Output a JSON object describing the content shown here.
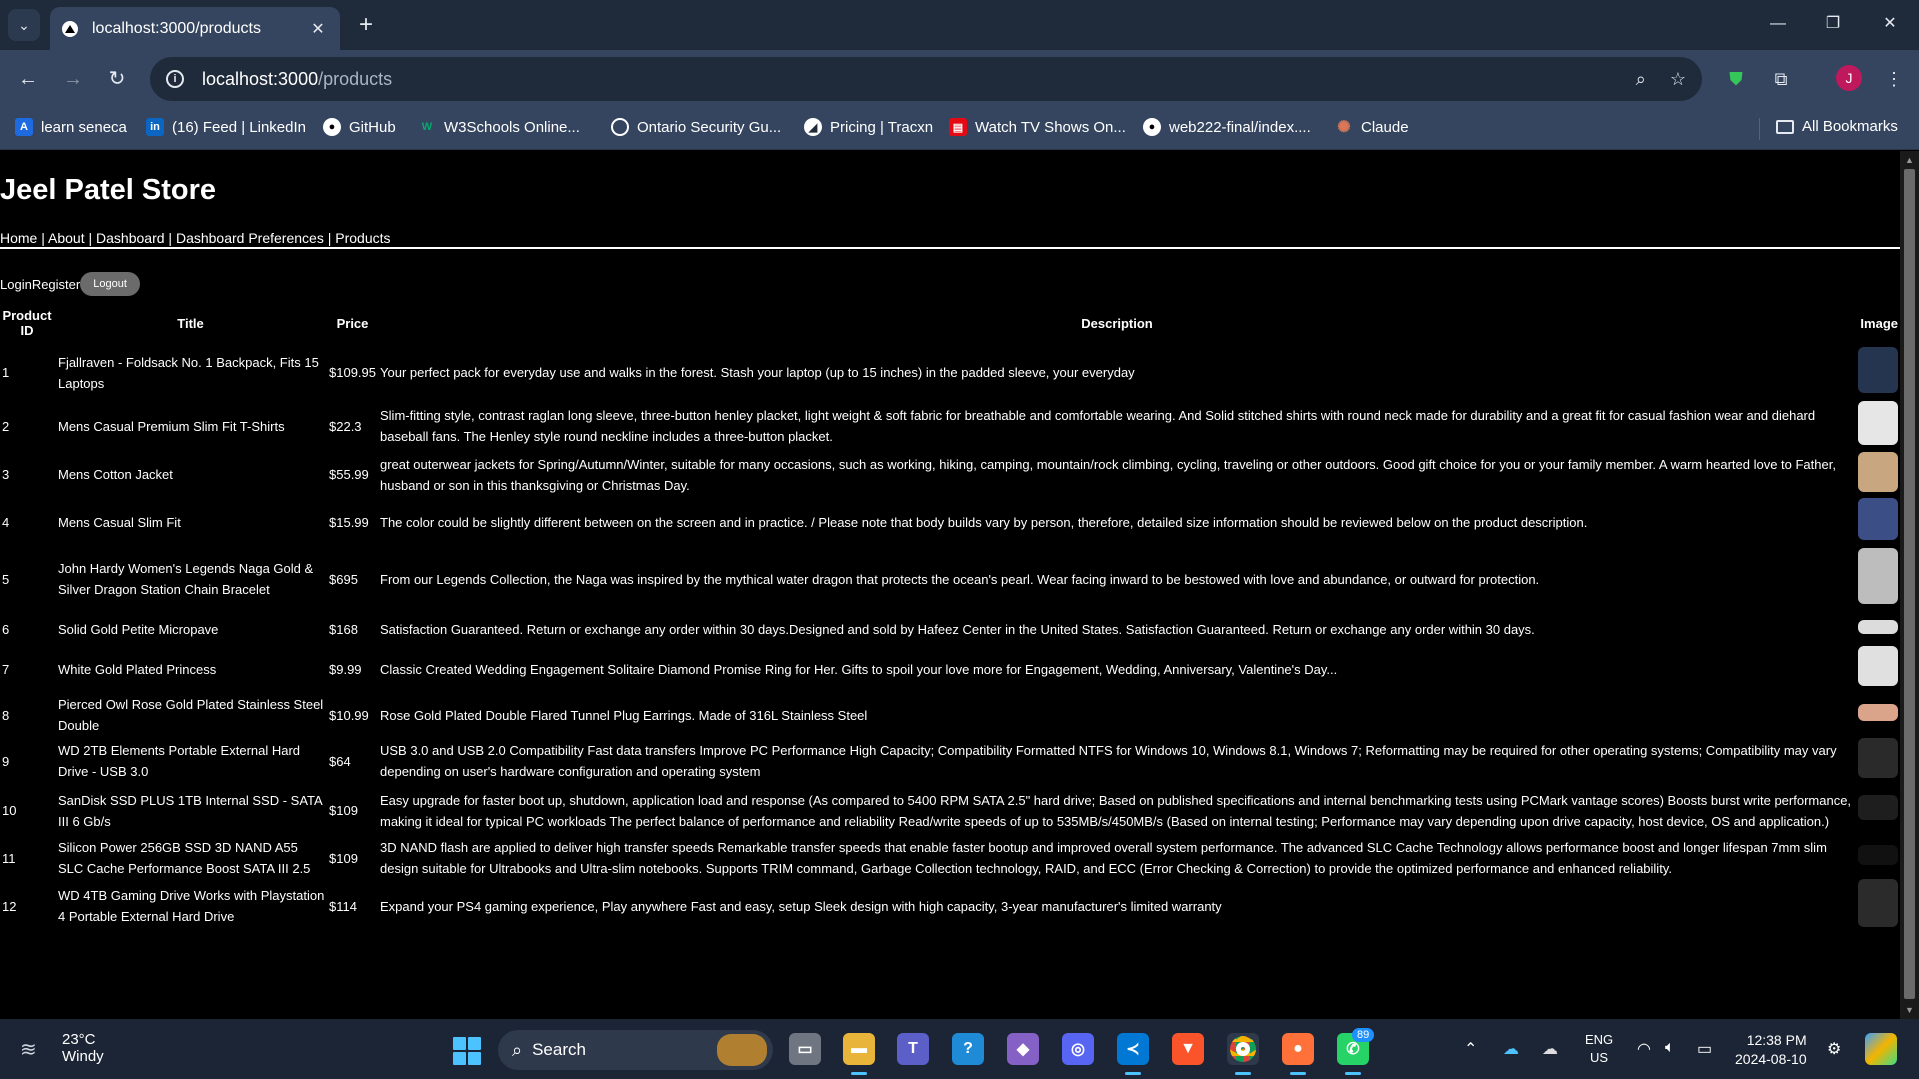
{
  "browser": {
    "tab_title": "localhost:3000/products",
    "url_host": "localhost:3000",
    "url_path": "/products",
    "profile_initial": "J",
    "bookmarks": [
      {
        "label": "learn seneca",
        "icon": "seneca-icon",
        "color": "#1e6ae0"
      },
      {
        "label": "(16) Feed | LinkedIn",
        "icon": "linkedin-icon",
        "color": "#0a66c2"
      },
      {
        "label": "GitHub",
        "icon": "github-icon",
        "color": "#ffffff"
      },
      {
        "label": "W3Schools Online...",
        "icon": "w3schools-icon",
        "color": "#04aa6d"
      },
      {
        "label": "Ontario Security Gu...",
        "icon": "globe-icon",
        "color": "#ffffff"
      },
      {
        "label": "Pricing | Tracxn",
        "icon": "tracxn-icon",
        "color": "#ffffff"
      },
      {
        "label": "Watch TV Shows On...",
        "icon": "tv-icon",
        "color": "#e50914"
      },
      {
        "label": "web222-final/index....",
        "icon": "github-icon",
        "color": "#ffffff"
      },
      {
        "label": "Claude",
        "icon": "claude-icon",
        "color": "#d97757"
      }
    ],
    "all_bookmarks": "All Bookmarks"
  },
  "site": {
    "title": "Jeel Patel Store",
    "nav": [
      "Home",
      "About",
      "Dashboard",
      "Dashboard Preferences",
      "Products"
    ],
    "login": "Login",
    "register": "Register",
    "logout": "Logout"
  },
  "table": {
    "headers": {
      "id": "Product ID",
      "title": "Title",
      "price": "Price",
      "description": "Description",
      "image": "Image"
    },
    "rows": [
      {
        "id": "1",
        "title": "Fjallraven - Foldsack No. 1 Backpack, Fits 15 Laptops",
        "price": "$109.95",
        "description": "Your perfect pack for everyday use and walks in the forest. Stash your laptop (up to 15 inches) in the padded sleeve, your everyday",
        "image": "backpack-image",
        "image_color": "#26354f"
      },
      {
        "id": "2",
        "title": "Mens Casual Premium Slim Fit T-Shirts",
        "price": "$22.3",
        "description": "Slim-fitting style, contrast raglan long sleeve, three-button henley placket, light weight & soft fabric for breathable and comfortable wearing. And Solid stitched shirts with round neck made for durability and a great fit for casual fashion wear and diehard baseball fans. The Henley style round neckline includes a three-button placket.",
        "image": "tshirt-image",
        "image_color": "#e6e6e6"
      },
      {
        "id": "3",
        "title": "Mens Cotton Jacket",
        "price": "$55.99",
        "description": "great outerwear jackets for Spring/Autumn/Winter, suitable for many occasions, such as working, hiking, camping, mountain/rock climbing, cycling, traveling or other outdoors. Good gift choice for you or your family member. A warm hearted love to Father, husband or son in this thanksgiving or Christmas Day.",
        "image": "jacket-image",
        "image_color": "#c8a780"
      },
      {
        "id": "4",
        "title": "Mens Casual Slim Fit",
        "price": "$15.99",
        "description": "The color could be slightly different between on the screen and in practice. / Please note that body builds vary by person, therefore, detailed size information should be reviewed below on the product description.",
        "image": "shirt-image",
        "image_color": "#3b4f86"
      },
      {
        "id": "5",
        "title": "John Hardy Women's Legends Naga Gold & Silver Dragon Station Chain Bracelet",
        "price": "$695",
        "description": "From our Legends Collection, the Naga was inspired by the mythical water dragon that protects the ocean's pearl. Wear facing inward to be bestowed with love and abundance, or outward for protection.",
        "image": "bracelet-image",
        "image_color": "#bdbdbd"
      },
      {
        "id": "6",
        "title": "Solid Gold Petite Micropave",
        "price": "$168",
        "description": "Satisfaction Guaranteed. Return or exchange any order within 30 days.Designed and sold by Hafeez Center in the United States. Satisfaction Guaranteed. Return or exchange any order within 30 days.",
        "image": "ring-image",
        "image_color": "#dcdcdc"
      },
      {
        "id": "7",
        "title": "White Gold Plated Princess",
        "price": "$9.99",
        "description": "Classic Created Wedding Engagement Solitaire Diamond Promise Ring for Her. Gifts to spoil your love more for Engagement, Wedding, Anniversary, Valentine's Day...",
        "image": "diamond-ring-image",
        "image_color": "#e0e0e0"
      },
      {
        "id": "8",
        "title": "Pierced Owl Rose Gold Plated Stainless Steel Double",
        "price": "$10.99",
        "description": "Rose Gold Plated Double Flared Tunnel Plug Earrings. Made of 316L Stainless Steel",
        "image": "earrings-image",
        "image_color": "#d9a48a"
      },
      {
        "id": "9",
        "title": "WD 2TB Elements Portable External Hard Drive - USB 3.0",
        "price": "$64",
        "description": "USB 3.0 and USB 2.0 Compatibility Fast data transfers Improve PC Performance High Capacity; Compatibility Formatted NTFS for Windows 10, Windows 8.1, Windows 7; Reformatting may be required for other operating systems; Compatibility may vary depending on user's hardware configuration and operating system",
        "image": "hard-drive-image",
        "image_color": "#2a2a2a"
      },
      {
        "id": "10",
        "title": "SanDisk SSD PLUS 1TB Internal SSD - SATA III 6 Gb/s",
        "price": "$109",
        "description": "Easy upgrade for faster boot up, shutdown, application load and response (As compared to 5400 RPM SATA 2.5\" hard drive; Based on published specifications and internal benchmarking tests using PCMark vantage scores) Boosts burst write performance, making it ideal for typical PC workloads The perfect balance of performance and reliability Read/write speeds of up to 535MB/s/450MB/s (Based on internal testing; Performance may vary depending upon drive capacity, host device, OS and application.)",
        "image": "ssd-image",
        "image_color": "#1e1e1e"
      },
      {
        "id": "11",
        "title": "Silicon Power 256GB SSD 3D NAND A55 SLC Cache Performance Boost SATA III 2.5",
        "price": "$109",
        "description": "3D NAND flash are applied to deliver high transfer speeds Remarkable transfer speeds that enable faster bootup and improved overall system performance. The advanced SLC Cache Technology allows performance boost and longer lifespan 7mm slim design suitable for Ultrabooks and Ultra-slim notebooks. Supports TRIM command, Garbage Collection technology, RAID, and ECC (Error Checking & Correction) to provide the optimized performance and enhanced reliability.",
        "image": "ssd-image",
        "image_color": "#111111"
      },
      {
        "id": "12",
        "title": "WD 4TB Gaming Drive Works with Playstation 4 Portable External Hard Drive",
        "price": "$114",
        "description": "Expand your PS4 gaming experience, Play anywhere Fast and easy, setup Sleek design with high capacity, 3-year manufacturer's limited warranty",
        "image": "gaming-drive-image",
        "image_color": "#2b2b2b"
      }
    ]
  },
  "taskbar": {
    "weather_temp": "23°C",
    "weather_desc": "Windy",
    "search_label": "Search",
    "whatsapp_badge": "89",
    "lang_1": "ENG",
    "lang_2": "US",
    "time": "12:38 PM",
    "date": "2024-08-10"
  }
}
